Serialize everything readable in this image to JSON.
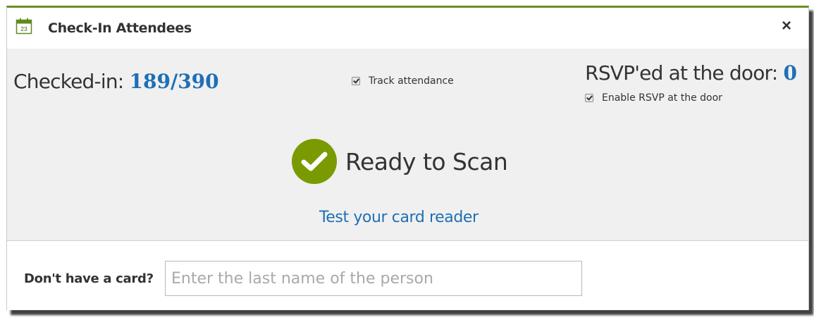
{
  "dialog": {
    "title": "Check-In Attendees",
    "title_icon": "calendar-icon",
    "calendar_day": "23",
    "close_label": "×"
  },
  "stats": {
    "checked_in_label": "Checked-in: ",
    "checked_in_count": "189",
    "checked_in_separator": "/",
    "checked_in_total": "390",
    "track_attendance_label": "Track attendance",
    "track_attendance_checked": true,
    "rsvp_label": "RSVP'ed at the door: ",
    "rsvp_count": "0",
    "enable_rsvp_label": "Enable RSVP at the door",
    "enable_rsvp_checked": true
  },
  "scan": {
    "status_icon": "check-circle-icon",
    "status_text": "Ready to Scan",
    "test_link": "Test your card reader"
  },
  "manual": {
    "label": "Don't have a card?",
    "input_value": "",
    "input_placeholder": "Enter the last name of the person"
  },
  "colors": {
    "accent": "#6b8e23",
    "ready_green": "#7a9a01",
    "link_blue": "#1f6fb5"
  }
}
